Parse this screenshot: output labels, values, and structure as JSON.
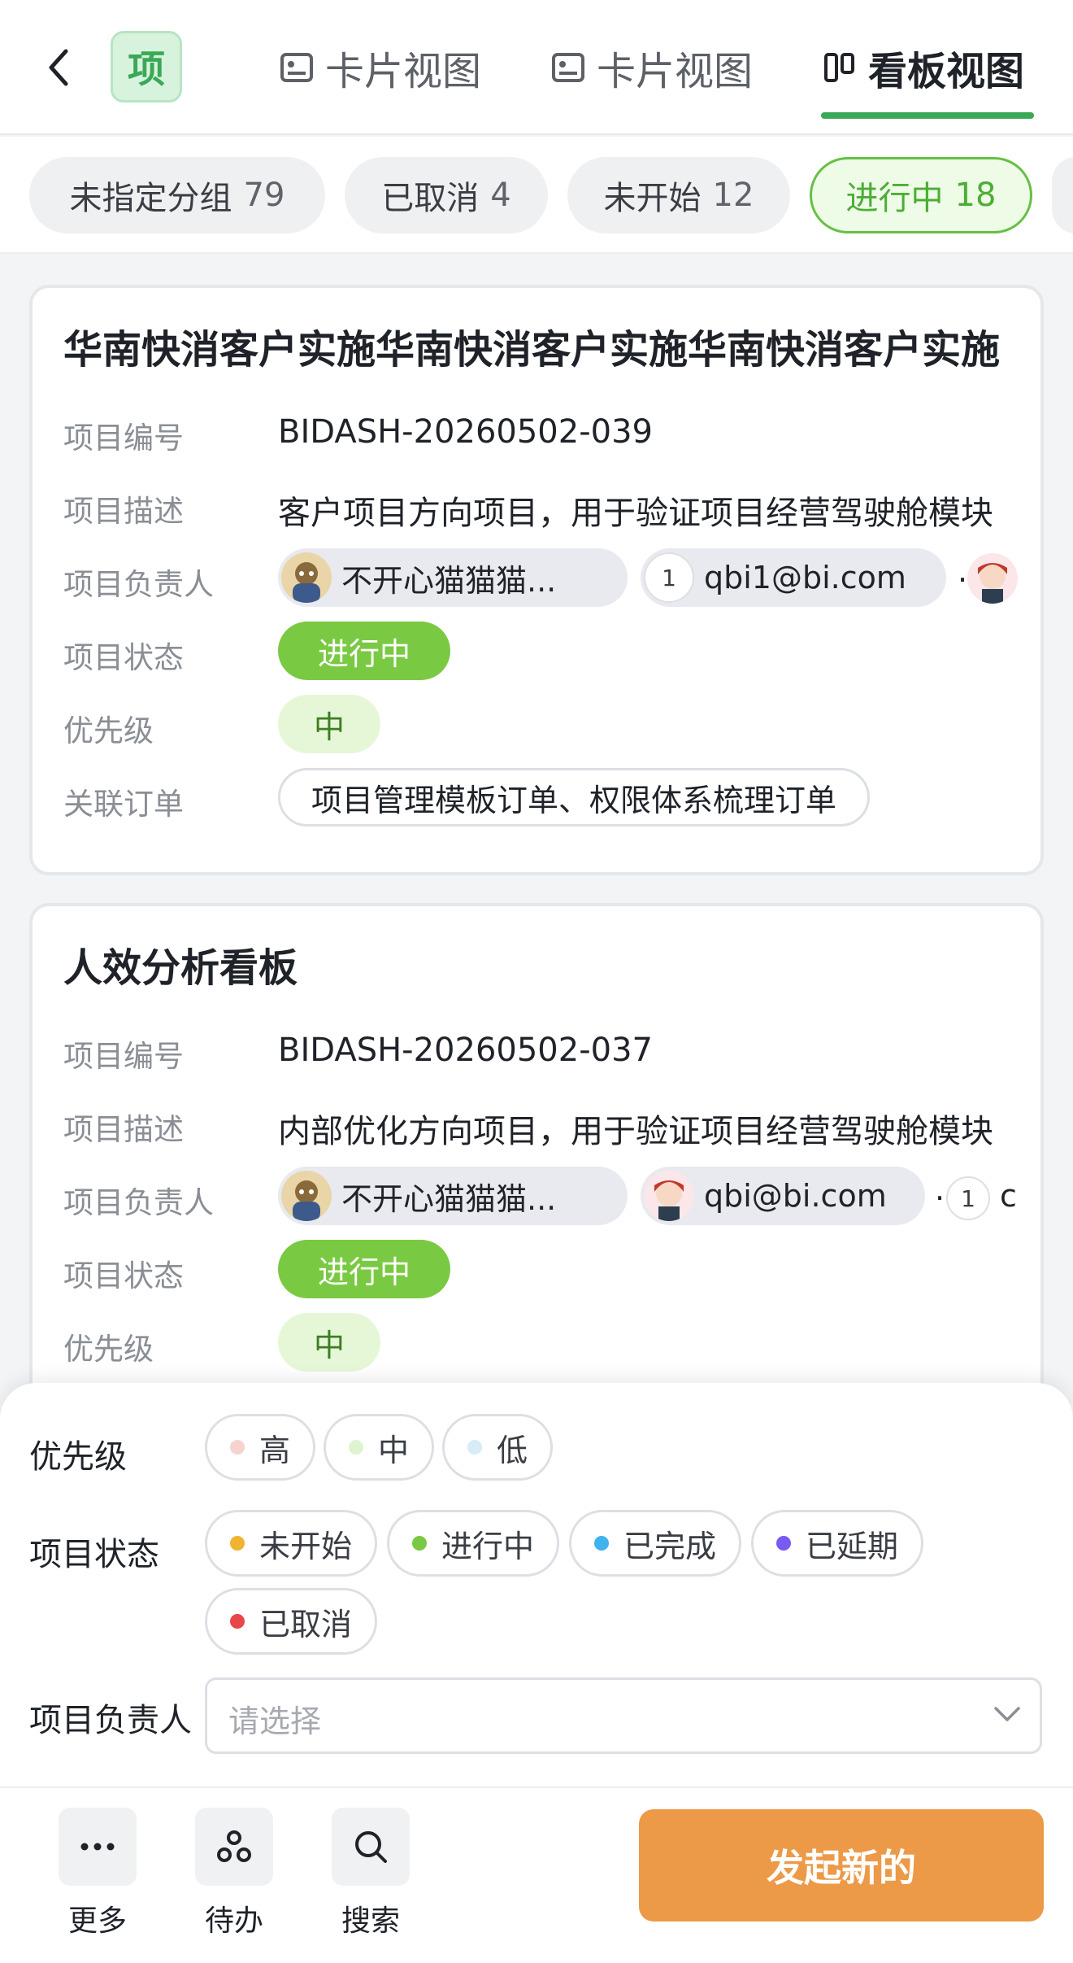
{
  "header": {
    "logo_text": "项",
    "tabs": [
      {
        "label": "卡片视图"
      },
      {
        "label": "卡片视图"
      },
      {
        "label": "看板视图"
      }
    ]
  },
  "groups": [
    {
      "label": "未指定分组",
      "count": "79"
    },
    {
      "label": "已取消",
      "count": "4"
    },
    {
      "label": "未开始",
      "count": "12"
    },
    {
      "label": "进行中",
      "count": "18"
    }
  ],
  "labels": {
    "code": "项目编号",
    "desc": "项目描述",
    "owner": "项目负责人",
    "status": "项目状态",
    "priority": "优先级",
    "order": "关联订单"
  },
  "cards": [
    {
      "title": "华南快消客户实施华南快消客户实施华南快消客户实施",
      "code": "BIDASH-20260502-039",
      "desc": "客户项目方向项目，用于验证项目经营驾驶舱模块",
      "owners": [
        "不开心猫猫猫...",
        "qbi1@bi.com"
      ],
      "owner_badge": "1",
      "more": ".",
      "status": "进行中",
      "priority": "中",
      "order": "项目管理模板订单、权限体系梳理订单"
    },
    {
      "title": "人效分析看板",
      "code": "BIDASH-20260502-037",
      "desc": "内部优化方向项目，用于验证项目经营驾驶舱模块",
      "owners": [
        "不开心猫猫猫...",
        "qbi@bi.com"
      ],
      "owner_badge": "1",
      "more": ".",
      "trailing": "c",
      "status": "进行中",
      "priority": "中"
    }
  ],
  "filters": {
    "priority_label": "优先级",
    "priority_options": [
      {
        "label": "高",
        "color": "#f6d3cf"
      },
      {
        "label": "中",
        "color": "#dff3cf"
      },
      {
        "label": "低",
        "color": "#d6ecf7"
      }
    ],
    "status_label": "项目状态",
    "status_options": [
      {
        "label": "未开始",
        "color": "#f0b431"
      },
      {
        "label": "进行中",
        "color": "#7ac943"
      },
      {
        "label": "已完成",
        "color": "#3fb2ef"
      },
      {
        "label": "已延期",
        "color": "#7a5af0"
      },
      {
        "label": "已取消",
        "color": "#e8464a"
      }
    ],
    "owner_label": "项目负责人",
    "owner_placeholder": "请选择"
  },
  "bottom_bar": {
    "items": [
      {
        "label": "更多",
        "icon": "more-icon"
      },
      {
        "label": "待办",
        "icon": "todo-icon"
      },
      {
        "label": "搜索",
        "icon": "search-icon"
      }
    ],
    "primary": "发起新的"
  },
  "colors": {
    "accent_green": "#3aa856",
    "status_green": "#7ac943",
    "primary_orange": "#ec9a48"
  }
}
